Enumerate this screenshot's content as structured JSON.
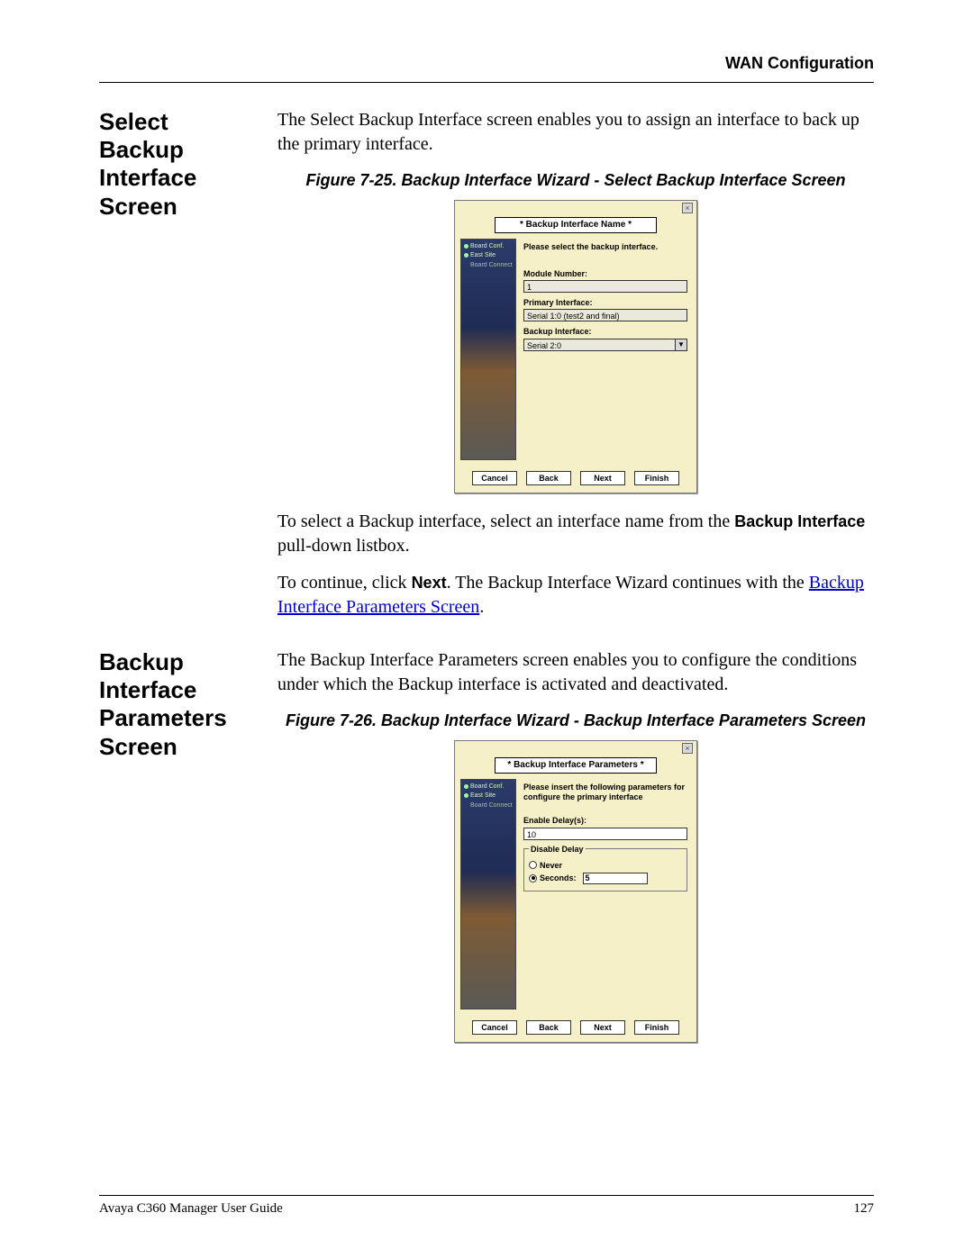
{
  "header": {
    "title": "WAN Configuration"
  },
  "section1": {
    "heading": "Select Backup Interface Screen",
    "intro": "The Select Backup Interface screen enables you to assign an interface to back up the primary interface.",
    "figcaption": "Figure 7-25.  Backup Interface Wizard - Select Backup Interface Screen",
    "para2_a": "To select a Backup interface, select an interface name from the ",
    "para2_b": "Backup Interface",
    "para2_c": " pull-down listbox.",
    "para3_a": "To continue, click ",
    "para3_b": "Next",
    "para3_c": ". The Backup Interface Wizard continues with the ",
    "para3_link": "Backup Interface Parameters Screen",
    "para3_d": "."
  },
  "wizard1": {
    "step_title": "* Backup Interface Name *",
    "prompt": "Please select the backup interface.",
    "side_items": [
      "Board Conf.",
      "East Site",
      "Board Connect"
    ],
    "module_label": "Module Number:",
    "module_value": "1",
    "primary_label": "Primary Interface:",
    "primary_value": "Serial 1:0 (test2 and final)",
    "backup_label": "Backup Interface:",
    "backup_value": "Serial 2:0",
    "btn_cancel": "Cancel",
    "btn_back": "Back",
    "btn_next": "Next",
    "btn_finish": "Finish"
  },
  "section2": {
    "heading": "Backup Interface Parameters Screen",
    "intro": "The Backup Interface Parameters screen enables you to configure the conditions under which the Backup interface is activated and deactivated.",
    "figcaption": "Figure 7-26.  Backup Interface Wizard - Backup Interface Parameters Screen"
  },
  "wizard2": {
    "step_title": "* Backup Interface Parameters *",
    "prompt": "Please insert the following parameters for configure the primary interface",
    "enable_label": "Enable Delay(s):",
    "enable_value": "10",
    "disable_legend": "Disable Delay",
    "never_label": "Never",
    "seconds_label": "Seconds:",
    "seconds_value": "5",
    "btn_cancel": "Cancel",
    "btn_back": "Back",
    "btn_next": "Next",
    "btn_finish": "Finish"
  },
  "footer": {
    "left": "Avaya C360 Manager User Guide",
    "right": "127"
  }
}
